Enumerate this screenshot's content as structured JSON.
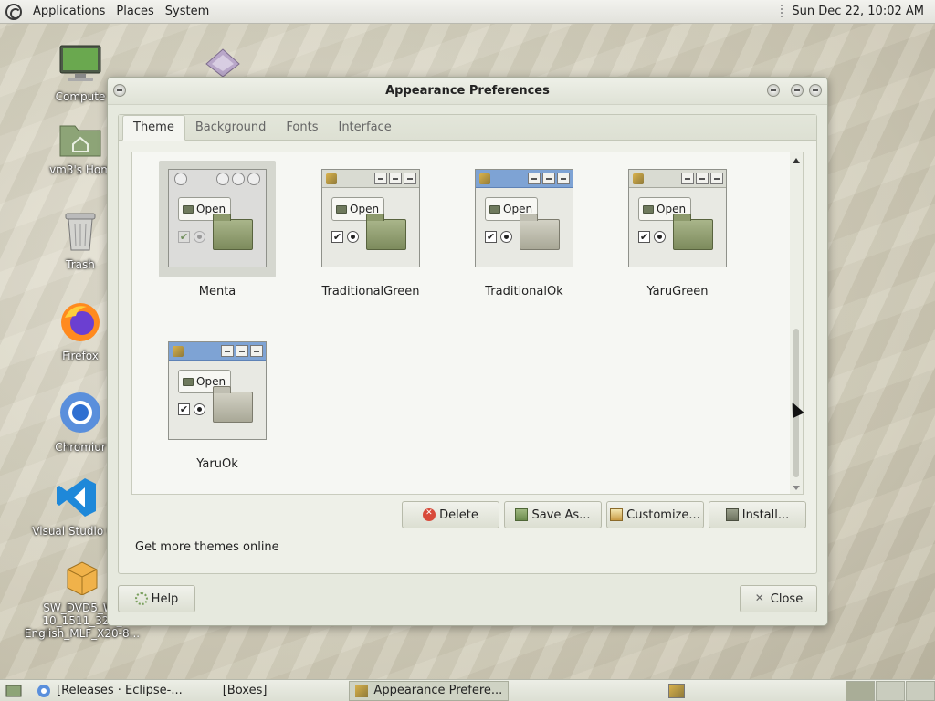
{
  "top_panel": {
    "menus": [
      "Applications",
      "Places",
      "System"
    ],
    "clock": "Sun Dec 22, 10:02 AM"
  },
  "desktop": {
    "icons": [
      {
        "label": "Compute",
        "icon": "computer-icon"
      },
      {
        "label": "vm3's Hom",
        "icon": "home-folder-icon"
      },
      {
        "label": "Trash",
        "icon": "trash-icon"
      },
      {
        "label": "Firefox",
        "icon": "firefox-icon"
      },
      {
        "label": "Chromiur",
        "icon": "chromium-icon"
      },
      {
        "label": "Visual Studio Co",
        "icon": "vscode-icon"
      },
      {
        "label": "SW_DVD5_Wir 10_1511_32B_ English_MLF_X20-8...",
        "icon": "package-icon"
      }
    ]
  },
  "window": {
    "title": "Appearance Preferences",
    "tabs": [
      "Theme",
      "Background",
      "Fonts",
      "Interface"
    ],
    "active_tab": "Theme",
    "themes": [
      {
        "name": "Menta",
        "selected": true
      },
      {
        "name": "TraditionalGreen",
        "selected": false
      },
      {
        "name": "TraditionalOk",
        "selected": false
      },
      {
        "name": "YaruGreen",
        "selected": false
      },
      {
        "name": "YaruOk",
        "selected": false
      }
    ],
    "preview_open_label": "Open",
    "buttons": {
      "delete": "Delete",
      "save_as": "Save As...",
      "customize": "Customize...",
      "install": "Install...",
      "help": "Help",
      "close": "Close"
    },
    "more_themes_link": "Get more themes online"
  },
  "taskbar": {
    "tasks": [
      {
        "label": "[Releases · Eclipse-...",
        "active": false
      },
      {
        "label": "[Boxes]",
        "active": false
      },
      {
        "label": "Appearance Prefere...",
        "active": true
      }
    ],
    "workspaces": 4,
    "active_workspace": 1
  },
  "colors": {
    "window_bg": "#e6e9de",
    "selection_bg": "#d5d7cf",
    "titlebar_blue": "#7ea3d4"
  }
}
